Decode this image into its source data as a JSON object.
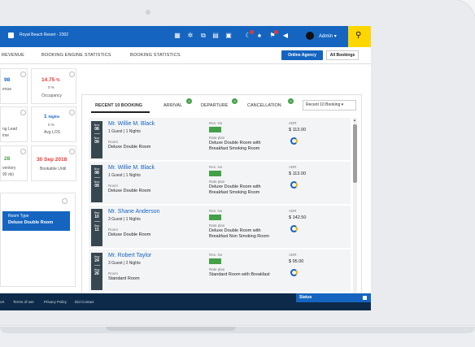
{
  "header": {
    "hotel_name": "Royal Beach Resort - 2302",
    "user_name": "Admin",
    "user_caret": "▾",
    "search_glyph": "⚲",
    "icons": [
      "building-icon",
      "settings-icon",
      "copy-icon",
      "calendar-icon",
      "chat-icon",
      "moon-icon",
      "bell-icon",
      "flag-icon",
      "megaphone-icon"
    ]
  },
  "nav": {
    "items": [
      "REVENUE",
      "BOOKING ENGINE STATISTICS",
      "BOOKING STATISTICS"
    ],
    "online_agency": "Online Agency",
    "all_bookings": "All Bookings"
  },
  "stats": {
    "s1_value": "98",
    "s1_sub": "enue",
    "s2_value": "14.75",
    "s2_unit": "%",
    "s2_delta": "0 %",
    "s2_label": "Occupancy",
    "s3_sub1": "ng Lead",
    "s3_sub2": "ime",
    "s4_value": "1",
    "s4_unit": "Nights",
    "s4_delta": "0 %",
    "s4_label": "Avg LOS",
    "s5_value": "28",
    "s5_sub1": "ventory",
    "s5_sub2": "90 ds)",
    "s6_value": "30 Sep 2018",
    "s6_label": "Bookable Until"
  },
  "room_card": {
    "label": "Room Type",
    "value": "Deluxe Double Room"
  },
  "bookings": {
    "tabs": [
      {
        "label": "RECENT 10 BOOKING"
      },
      {
        "label": "ARRIVAL",
        "badge": "2"
      },
      {
        "label": "DEPARTURE",
        "badge": "0"
      },
      {
        "label": "CANCELLATION",
        "badge": "0"
      }
    ],
    "filter": "Recent 10 Booking",
    "res_label": "Res. No",
    "room_label": "Room",
    "rate_label": "Rate plan",
    "adr_label": "ADR",
    "rows": [
      {
        "m1": "Nov",
        "d1": "08",
        "m2": "Nov",
        "d2": "09",
        "name": "Mr. Willie M. Black",
        "meta": "1 Guest | 1 Nights",
        "room": "Deluxe Double Room",
        "rate1": "Deluxe Double Room with",
        "rate2": "Breakfast Smoking Room",
        "price": "$ 113.00"
      },
      {
        "m1": "Nov",
        "d1": "08",
        "m2": "Nov",
        "d2": "09",
        "name": "Mr. Willie M. Black",
        "meta": "1 Guest | 1 Nights",
        "room": "Deluxe Double Room",
        "rate1": "Deluxe Double Room with",
        "rate2": "Breakfast Smoking Room",
        "price": "$ 113.00"
      },
      {
        "m1": "Sep",
        "d1": "10",
        "m2": "Sep",
        "d2": "11",
        "name": "Mr. Shane Anderson",
        "meta": "3 Guest | 1 Nights",
        "room": "Deluxe Double Room",
        "rate1": "Deluxe Double Room with",
        "rate2": "Breakfast Non Smoking Room",
        "price": "$ 142.50"
      },
      {
        "m1": "Aug",
        "d1": "24",
        "m2": "Aug",
        "d2": "26",
        "name": "Mr. Robert Taylor",
        "meta": "3 Guest | 2 Nights",
        "room": "Standard Room",
        "rate1": "Standard Room with Breakfast",
        "rate2": "",
        "price": "$ 95.00"
      }
    ]
  },
  "footer": {
    "links": [
      "ort",
      "Terms of use",
      "Privacy Policy",
      "Did Contact"
    ],
    "status": "Status"
  }
}
